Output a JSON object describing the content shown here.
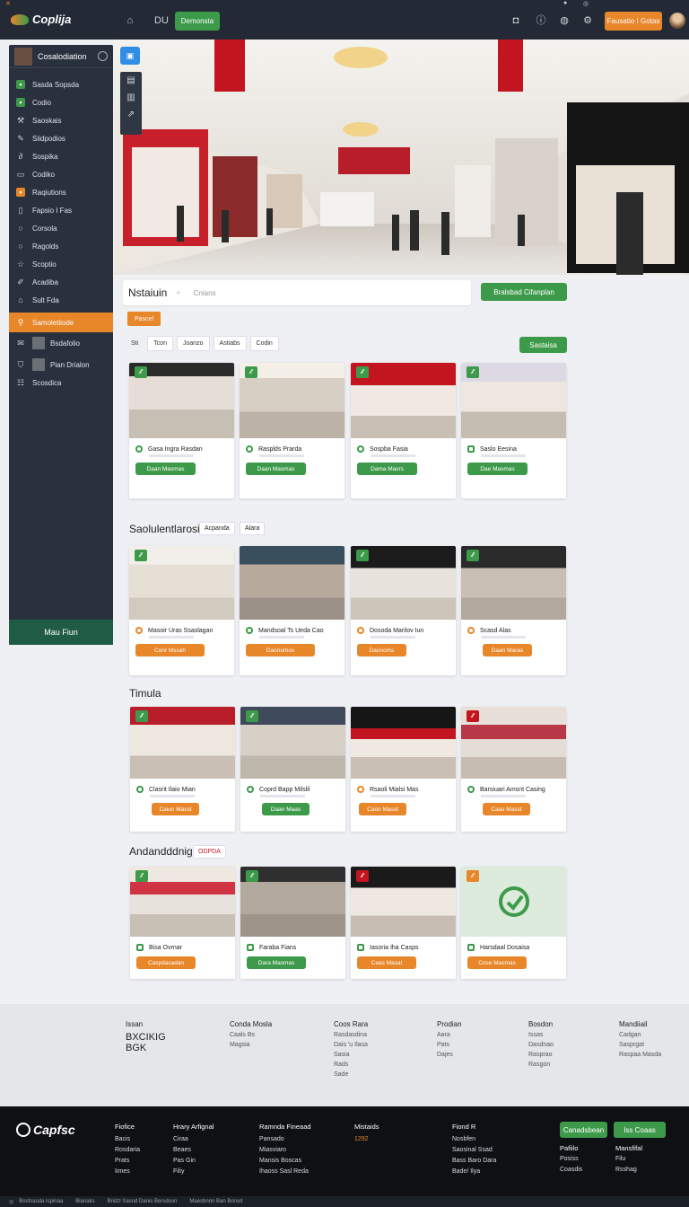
{
  "header": {
    "logo": "Coplija",
    "tab_label": "DU",
    "green_button": "Demonsta",
    "orange_button": "Fausatio I Gotas",
    "icons": [
      "home-icon",
      "bookmark-icon",
      "bell-icon",
      "info-icon",
      "settings-icon"
    ]
  },
  "sidebar": {
    "title": "Cosalodiation",
    "items": [
      {
        "label": "Sasda Sopsda",
        "icon": "grid-icon"
      },
      {
        "label": "Codio",
        "icon": "pin-icon"
      },
      {
        "label": "Saoskais",
        "icon": "tool-icon"
      },
      {
        "label": "Siidpodios",
        "icon": "tag-icon"
      },
      {
        "label": "Sospika",
        "icon": "link-icon"
      },
      {
        "label": "Codiko",
        "icon": "shop-icon"
      },
      {
        "label": "Raqiutions",
        "icon": "box-icon"
      },
      {
        "label": "Fapsio I Fas",
        "icon": "doc-icon"
      },
      {
        "label": "Corsola",
        "icon": "circle-icon"
      },
      {
        "label": "Ragolds",
        "icon": "circle-icon"
      },
      {
        "label": "Scoptio",
        "icon": "star-icon"
      },
      {
        "label": "Acadiba",
        "icon": "edit-icon"
      },
      {
        "label": "Sult Fda",
        "icon": "home-icon"
      },
      {
        "label": "Samoletiiode",
        "icon": "search-icon"
      },
      {
        "label": "Bsdafolio",
        "icon": "mail-icon"
      },
      {
        "label": "Pian Drialon",
        "icon": "shield-icon"
      },
      {
        "label": "Scosdica",
        "icon": "list-icon"
      }
    ],
    "footer": "Mau Fiun"
  },
  "toolbar": {
    "title": "Nstaiuin",
    "placeholder": "Cnians",
    "cta": "Bralsbad Cifanplan",
    "tag": "Pascel",
    "chips": [
      "Sti",
      "Tcon",
      "Joanzo",
      "Astiabs",
      "Codin"
    ],
    "right_button": "Sastaisa"
  },
  "section1": {
    "cards": [
      {
        "name": "Gasa Ingra Rasdan",
        "button": "Daan Masmas"
      },
      {
        "name": "Rasplds Prarda",
        "button": "Daan Masmas"
      },
      {
        "name": "Sospba Fasia",
        "button": "Dama Masrs"
      },
      {
        "name": "Saslo Eesina",
        "button": "Dae Masmas"
      }
    ]
  },
  "section2": {
    "title": "Saolulentlarosi",
    "chips": [
      "Acpanda",
      "Alara"
    ],
    "cards": [
      {
        "name": "Masoir Uras Ssaslagan",
        "button": "Conr Mssah"
      },
      {
        "name": "Mandsoal Ts Ueda Cao",
        "button": "Daonomos"
      },
      {
        "name": "Dosoda Marilov Iun",
        "button": "Daonoms"
      },
      {
        "name": "Scasd Alas",
        "button": "Daan Maras"
      }
    ]
  },
  "section3": {
    "title": "Timula",
    "cards": [
      {
        "name": "Clasrit Ilaio Mian",
        "button": "Caiun Masst"
      },
      {
        "name": "Coprd Bapp Milslil",
        "button": "Daan Maas"
      },
      {
        "name": "Rsaoli Mialsi Mas",
        "button": "Caon Masst"
      },
      {
        "name": "Barsiuari Amsnt Casing",
        "button": "Caas Masst"
      }
    ]
  },
  "section4": {
    "title": "Andandddnig",
    "tag": "ODPDA",
    "cards": [
      {
        "name": "Bisa Ovrnar",
        "button": "Caspdasadan"
      },
      {
        "name": "Faraba Fians",
        "button": "Dara Masmas"
      },
      {
        "name": "Iasoria Iha Casps",
        "button": "Caas Masat"
      },
      {
        "name": "Harsdaal Dosaisa",
        "button": "Cose Masmas"
      }
    ]
  },
  "footer_top": {
    "columns": [
      {
        "title": "Issan",
        "items": [
          "BXCIKIG",
          "BGK"
        ]
      },
      {
        "title": "Conda Mosla",
        "items": [
          "Caals Bs",
          "Magsia"
        ]
      },
      {
        "title": "Coos Rara",
        "items": [
          "Rasdasdina",
          "Dais 'u Ilasa",
          "Sasia",
          "Rads",
          "Sade"
        ]
      },
      {
        "title": "Prodian",
        "items": [
          "Aara",
          "Pats",
          "Dajes"
        ]
      },
      {
        "title": "Bosdon",
        "items": [
          "Issas",
          "Dasdnao",
          "Rasprao",
          "Rasgon"
        ]
      },
      {
        "title": "Mandiiail",
        "items": [
          "Cadgan",
          "Sasprgat",
          "Raspaa Masda"
        ]
      }
    ]
  },
  "footer_bottom": {
    "logo": "Capfsc",
    "columns": [
      {
        "title": "Fiofice",
        "items": [
          "Bacis",
          "Rosdaria",
          "Prats",
          "Iimes"
        ]
      },
      {
        "title": "Hrary Arfignal",
        "items": [
          "Ciraa",
          "Beaes",
          "Pas Gin",
          "Filiy"
        ]
      },
      {
        "title": "Ramnda Fineaad",
        "items": [
          "Pansado",
          "Miasviaro",
          "Mansis Boscas",
          "Ihaoss Sasl Reda"
        ]
      },
      {
        "title": "Mistaids",
        "items": [
          "1292"
        ]
      },
      {
        "title": "Fiond R",
        "items": [
          "Nosbfen",
          "Saosinal Ssad",
          "Bass Baro Dara",
          "Bade/ Ilya"
        ]
      }
    ],
    "buttons": [
      "Canadsbean",
      "Iss Coaas"
    ],
    "right_columns": [
      {
        "title": "Pafiilo",
        "items": [
          "Posiss",
          "Coasdis"
        ]
      },
      {
        "title": "Mansfifal",
        "items": [
          "Filu",
          "Rsshag"
        ]
      }
    ],
    "bar": [
      "Bostsasda Ispinaa",
      "Bianaks",
      "Bridzl Sasnd Danis Bersdson",
      "Maesbnnn Ban Bonsd"
    ]
  },
  "colors": {
    "accent_orange": "#e8862a",
    "accent_green": "#3d9a4a",
    "sidebar_bg": "#29313e",
    "header_bg": "#232a35"
  }
}
